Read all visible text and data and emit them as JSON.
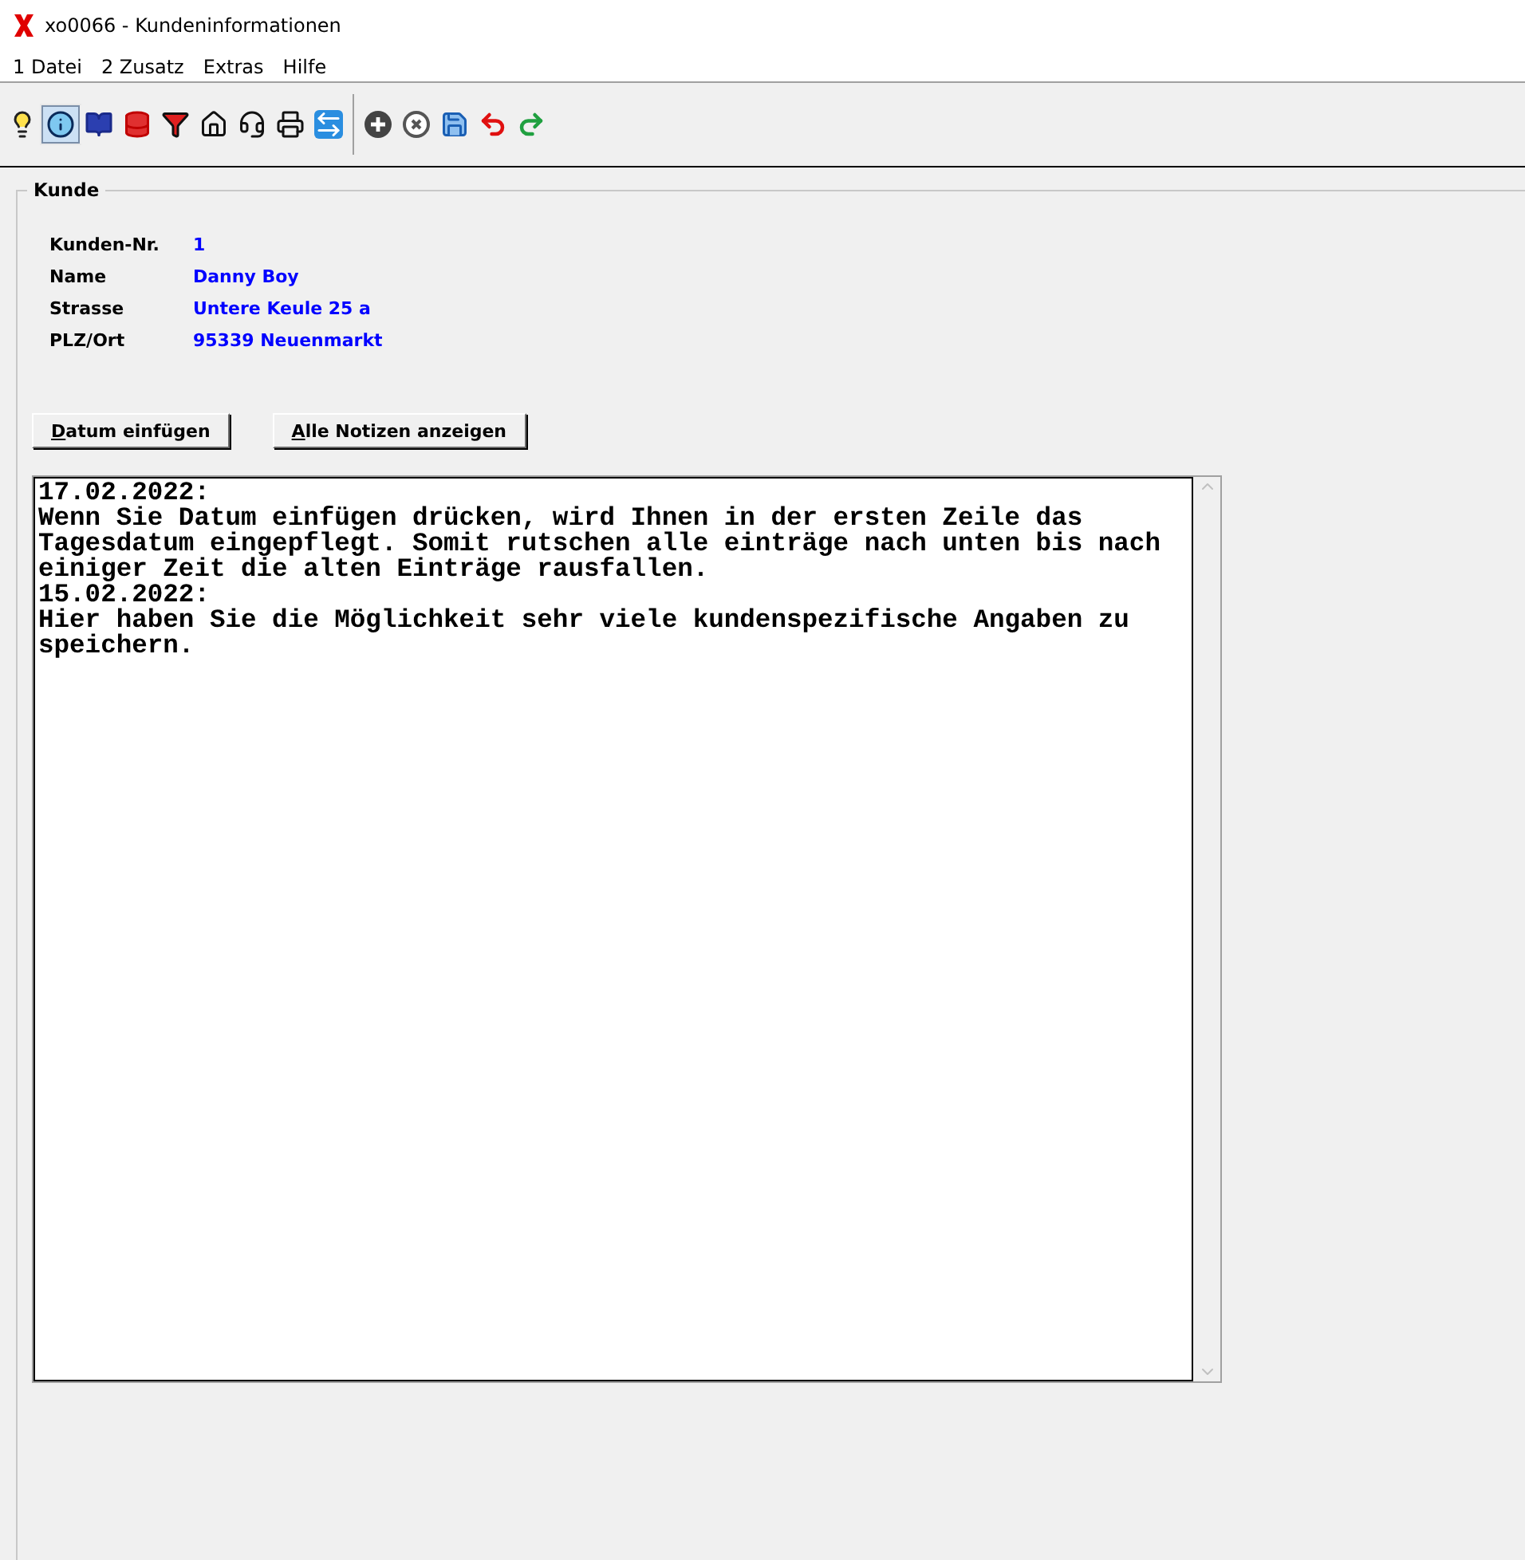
{
  "window": {
    "title": "xo0066 - Kundeninformationen"
  },
  "menu": [
    "1 Datei",
    "2 Zusatz",
    "Extras",
    "Hilfe"
  ],
  "toolbar": [
    {
      "kind": "bulb",
      "selected": false
    },
    {
      "kind": "info",
      "selected": true
    },
    {
      "kind": "book",
      "selected": false
    },
    {
      "kind": "database",
      "selected": false
    },
    {
      "kind": "filter",
      "selected": false
    },
    {
      "kind": "home",
      "selected": false
    },
    {
      "kind": "headset",
      "selected": false
    },
    {
      "kind": "printer",
      "selected": false
    },
    {
      "kind": "remote",
      "selected": false
    },
    {
      "kind": "separator"
    },
    {
      "kind": "add",
      "selected": false
    },
    {
      "kind": "cancel",
      "selected": false
    },
    {
      "kind": "save",
      "selected": false
    },
    {
      "kind": "undo",
      "selected": false
    },
    {
      "kind": "redo",
      "selected": false
    }
  ],
  "group": {
    "title": "Kunde",
    "fields": [
      {
        "label": "Kunden-Nr.",
        "value": "1"
      },
      {
        "label": "Name",
        "value": "Danny Boy"
      },
      {
        "label": "Strasse",
        "value": "Untere Keule 25 a"
      },
      {
        "label": "PLZ/Ort",
        "value": "95339 Neuenmarkt"
      }
    ],
    "buttons": [
      "Datum einfügen",
      "Alle Notizen anzeigen"
    ],
    "notes": [
      "17.02.2022:",
      "Wenn Sie Datum einfügen drücken, wird Ihnen in der ersten Zeile das",
      "Tagesdatum eingepflegt. Somit rutschen alle einträge nach unten bis nach",
      "einiger Zeit die alten Einträge rausfallen.",
      "15.02.2022:",
      "Hier haben Sie die Möglichkeit sehr viele kundenspezifische Angaben zu",
      "speichern."
    ]
  }
}
